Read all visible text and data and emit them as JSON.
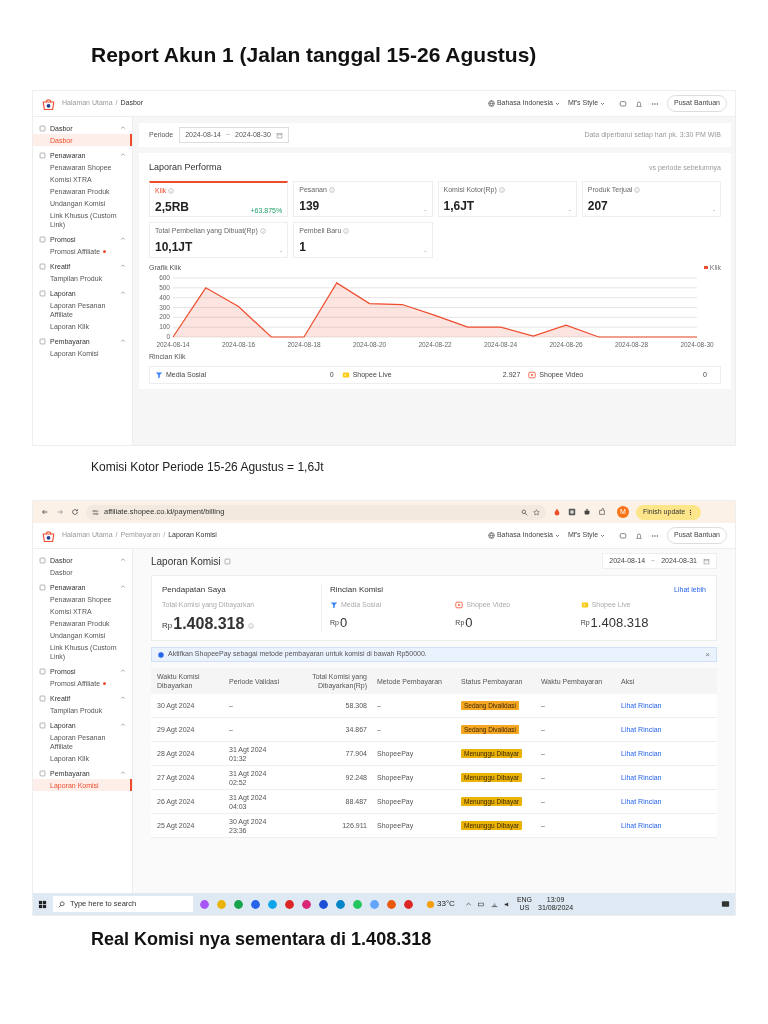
{
  "title": "Report Akun 1 (Jalan tanggal 15-26 Agustus)",
  "screenshot_1": {
    "header": {
      "breadcrumb": [
        "Halaman Utama",
        "Dasbor"
      ],
      "separator": "/",
      "language": "Bahasa Indonesia",
      "account": "Mf's Style",
      "help": "Pusat Bantuan"
    },
    "sidebar": [
      {
        "label": "Dasbor",
        "items": [
          {
            "label": "Dasbor",
            "selected": true,
            "dot": false
          }
        ]
      },
      {
        "label": "Penawaran",
        "items": [
          {
            "label": "Penawaran Shopee",
            "selected": false,
            "dot": false
          },
          {
            "label": "Komisi XTRA",
            "selected": false,
            "dot": false
          },
          {
            "label": "Penawaran Produk",
            "selected": false,
            "dot": false
          },
          {
            "label": "Undangan Komisi",
            "selected": false,
            "dot": false
          },
          {
            "label": "Link Khusus (Custom Link)",
            "selected": false,
            "dot": false
          }
        ]
      },
      {
        "label": "Promosi",
        "items": [
          {
            "label": "Promosi Affiliate",
            "selected": false,
            "dot": true
          }
        ]
      },
      {
        "label": "Kreatif",
        "items": [
          {
            "label": "Tampilan Produk",
            "selected": false,
            "dot": false
          }
        ]
      },
      {
        "label": "Laporan",
        "items": [
          {
            "label": "Laporan Pesanan Affiliate",
            "selected": false,
            "dot": false
          },
          {
            "label": "Laporan Klik",
            "selected": false,
            "dot": false
          }
        ]
      },
      {
        "label": "Pembayaran",
        "items": [
          {
            "label": "Laporan Komisi",
            "selected": false,
            "dot": false
          }
        ]
      }
    ],
    "period": {
      "label": "Periode",
      "start": "2024-08-14",
      "separator": "~",
      "end": "2024-08-30",
      "note": "Data diperbarui setiap hari pk. 3:30 PM WIB"
    },
    "performance": {
      "title": "Laporan Performa",
      "compare": "vs periode sebelumnya",
      "metrics": [
        {
          "label": "Klik",
          "value": "2,5RB",
          "change": "+63.875%",
          "selected": true
        },
        {
          "label": "Pesanan",
          "value": "139",
          "change": "-",
          "selected": false
        },
        {
          "label": "Komisi Kotor(Rp)",
          "value": "1,6JT",
          "change": "-",
          "selected": false
        },
        {
          "label": "Produk Terjual",
          "value": "207",
          "change": "-",
          "selected": false
        },
        {
          "label": "Total Pembelian yang Dibuat(Rp)",
          "value": "10,1JT",
          "change": "-",
          "selected": false
        },
        {
          "label": "Pembeli Baru",
          "value": "1",
          "change": "-",
          "selected": false
        }
      ],
      "chart_title": "Grafik Klik",
      "chart_data": {
        "type": "area",
        "x": [
          "2024-08-14",
          "2024-08-15",
          "2024-08-16",
          "2024-08-17",
          "2024-08-18",
          "2024-08-19",
          "2024-08-20",
          "2024-08-21",
          "2024-08-22",
          "2024-08-23",
          "2024-08-24",
          "2024-08-25",
          "2024-08-26",
          "2024-08-27",
          "2024-08-28",
          "2024-08-29",
          "2024-08-30"
        ],
        "series": [
          {
            "name": "Klik",
            "color": "#ee4d2d",
            "values": [
              0,
              500,
              310,
              0,
              0,
              550,
              340,
              330,
              220,
              100,
              100,
              10,
              120,
              0,
              0,
              0,
              0
            ]
          }
        ],
        "xlim": [
          "2024-08-14",
          "2024-08-30"
        ],
        "grid": true,
        "ylim": [
          0,
          600
        ],
        "yticks": [
          0,
          100,
          200,
          300,
          400,
          500,
          600
        ],
        "xticks": [
          "2024-08-14",
          "2024-08-16",
          "2024-08-18",
          "2024-08-20",
          "2024-08-22",
          "2024-08-24",
          "2024-08-26",
          "2024-08-28",
          "2024-08-30"
        ]
      },
      "breakdown_title": "Rincian Klik",
      "breakdown": [
        {
          "label": "Media Sosial",
          "value": "0",
          "kind": "social"
        },
        {
          "label": "Shopee Live",
          "value": "2.927",
          "kind": "live"
        },
        {
          "label": "Shopee Video",
          "value": "0",
          "kind": "video"
        }
      ]
    }
  },
  "caption_1": "Komisi Kotor Periode 15-26 Agustus = 1,6Jt",
  "screenshot_2": {
    "browser": {
      "url": "affiliate.shopee.co.id/payment/billing",
      "profile": "M",
      "update": "Finish update"
    },
    "header": {
      "breadcrumb": [
        "Halaman Utama",
        "Pembayaran",
        "Laporan Komisi"
      ],
      "separator": "/",
      "language": "Bahasa Indonesia",
      "account": "Mf's Style",
      "help": "Pusat Bantuan"
    },
    "sidebar": [
      {
        "label": "Dasbor",
        "items": [
          {
            "label": "Dasbor",
            "selected": false,
            "dot": false
          }
        ]
      },
      {
        "label": "Penawaran",
        "items": [
          {
            "label": "Penawaran Shopee",
            "selected": false,
            "dot": false
          },
          {
            "label": "Komisi XTRA",
            "selected": false,
            "dot": false
          },
          {
            "label": "Penawaran Produk",
            "selected": false,
            "dot": false
          },
          {
            "label": "Undangan Komisi",
            "selected": false,
            "dot": false
          },
          {
            "label": "Link Khusus (Custom Link)",
            "selected": false,
            "dot": false
          }
        ]
      },
      {
        "label": "Promosi",
        "items": [
          {
            "label": "Promosi Affiliate",
            "selected": false,
            "dot": true
          }
        ]
      },
      {
        "label": "Kreatif",
        "items": [
          {
            "label": "Tampilan Produk",
            "selected": false,
            "dot": false
          }
        ]
      },
      {
        "label": "Laporan",
        "items": [
          {
            "label": "Laporan Pesanan Affiliate",
            "selected": false,
            "dot": false
          },
          {
            "label": "Laporan Klik",
            "selected": false,
            "dot": false
          }
        ]
      },
      {
        "label": "Pembayaran",
        "items": [
          {
            "label": "Laporan Komisi",
            "selected": true,
            "dot": false
          }
        ]
      }
    ],
    "page_title": "Laporan Komisi",
    "date_start": "2024-08-14",
    "date_separator": "~",
    "date_end": "2024-08-31",
    "earnings": {
      "title": "Pendapatan Saya",
      "label": "Total Komisi yang Dibayarkan",
      "currency": "Rp",
      "amount": "1.408.318"
    },
    "breakdown": {
      "title": "Rincian Komisi",
      "more": "Lihat lebih",
      "items": [
        {
          "label": "Media Sosial",
          "currency": "Rp",
          "amount": "0",
          "kind": "social"
        },
        {
          "label": "Shopee Video",
          "currency": "Rp",
          "amount": "0",
          "kind": "video"
        },
        {
          "label": "Shopee Live",
          "currency": "Rp",
          "amount": "1.408.318",
          "kind": "live"
        }
      ]
    },
    "alert": "Aktifkan ShopeePay sebagai metode pembayaran untuk komisi di bawah Rp50000.",
    "alert_close": "×",
    "table": {
      "columns": [
        "Waktu Komisi Dibayarkan",
        "Periode Validasi",
        "Total Komisi yang Dibayarkan(Rp)",
        "Metode Pembayaran",
        "Status Pembayaran",
        "Waktu Pembayaran",
        "Aksi"
      ],
      "rows": [
        {
          "paid_time": "30 Agt 2024",
          "validation": "–",
          "total": "58.308",
          "method": "–",
          "status": "Sedang Divalidasi",
          "color": "#f5a623",
          "payment_time": "–",
          "action": "Lihat Rincian"
        },
        {
          "paid_time": "29 Agt 2024",
          "validation": "–",
          "total": "34.867",
          "method": "–",
          "status": "Sedang Divalidasi",
          "color": "#f5a623",
          "payment_time": "–",
          "action": "Lihat Rincian"
        },
        {
          "paid_time": "28 Agt 2024",
          "validation": "31 Agt 2024\n01:32",
          "total": "77.904",
          "method": "ShopeePay",
          "status": "Menunggu Dibayar",
          "color": "#eab308",
          "payment_time": "–",
          "action": "Lihat Rincian"
        },
        {
          "paid_time": "27 Agt 2024",
          "validation": "31 Agt 2024\n02:52",
          "total": "92.248",
          "method": "ShopeePay",
          "status": "Menunggu Dibayar",
          "color": "#eab308",
          "payment_time": "–",
          "action": "Lihat Rincian"
        },
        {
          "paid_time": "26 Agt 2024",
          "validation": "31 Agt 2024\n04:03",
          "total": "88.487",
          "method": "ShopeePay",
          "status": "Menunggu Dibayar",
          "color": "#eab308",
          "payment_time": "–",
          "action": "Lihat Rincian"
        },
        {
          "paid_time": "25 Agt 2024",
          "validation": "30 Agt 2024\n23:36",
          "total": "126.911",
          "method": "ShopeePay",
          "status": "Menunggu Dibayar",
          "color": "#eab308",
          "payment_time": "–",
          "action": "Lihat Rincian"
        }
      ]
    },
    "taskbar": {
      "search": "Type here to search",
      "weather": "33°C",
      "language": "ENG",
      "region": "US",
      "time": "13:09",
      "date": "31/08/2024"
    }
  },
  "caption_2": "Real Komisi nya sementara di 1.408.318"
}
